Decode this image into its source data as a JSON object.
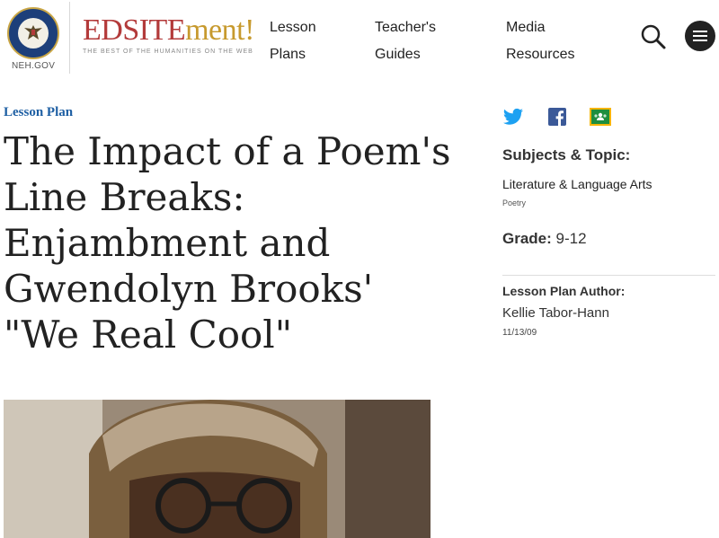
{
  "header": {
    "logo_label": "NEH.GOV",
    "brand_main": "EDSITE",
    "brand_accent": "ment!",
    "tagline": "THE BEST OF THE HUMANITIES ON THE WEB",
    "nav": [
      {
        "line1": "Lesson",
        "line2": "Plans"
      },
      {
        "line1": "Teacher's",
        "line2": "Guides"
      },
      {
        "line1": "Media",
        "line2": "Resources"
      }
    ]
  },
  "article": {
    "kicker": "Lesson Plan",
    "title": "The Impact of a Poem's Line Breaks: Enjambment and Gwendolyn Brooks' \"We Real Cool\""
  },
  "sidebar": {
    "subjects_heading": "Subjects & Topic:",
    "subject": "Literature & Language Arts",
    "subsubject": "Poetry",
    "grade_label": "Grade:",
    "grade_value": " 9-12",
    "author_heading": "Lesson Plan Author:",
    "author": "Kellie Tabor-Hann",
    "date": "11/13/09"
  },
  "colors": {
    "brand_red": "#b33a3a",
    "brand_gold": "#c79a2e",
    "kicker_blue": "#1e5fa3",
    "twitter": "#1da1f2",
    "facebook": "#3b5998",
    "classroom": "#1e8e3e"
  },
  "icons": [
    "seal-logo",
    "search-icon",
    "menu-icon",
    "twitter-icon",
    "facebook-icon",
    "google-classroom-icon"
  ]
}
